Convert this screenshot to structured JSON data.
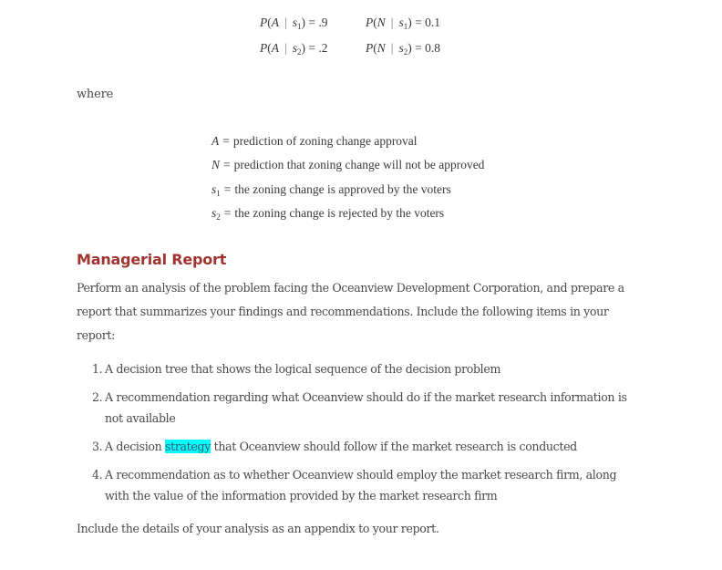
{
  "probabilities": [
    {
      "left": {
        "event": "A",
        "state": "s",
        "state_index": "1",
        "value": ".9"
      },
      "right": {
        "event": "N",
        "state": "s",
        "state_index": "1",
        "value": "0.1"
      }
    },
    {
      "left": {
        "event": "A",
        "state": "s",
        "state_index": "2",
        "value": ".2"
      },
      "right": {
        "event": "N",
        "state": "s",
        "state_index": "2",
        "value": "0.8"
      }
    }
  ],
  "where_label": "where",
  "definitions": [
    {
      "symbol": "A",
      "subscript": "",
      "text": "prediction of zoning change approval"
    },
    {
      "symbol": "N",
      "subscript": "",
      "text": "prediction that zoning change will not be approved"
    },
    {
      "symbol": "s",
      "subscript": "1",
      "text": "the zoning change is approved by the voters"
    },
    {
      "symbol": "s",
      "subscript": "2",
      "text": "the zoning change is rejected by the voters"
    }
  ],
  "report": {
    "heading": "Managerial Report",
    "intro": "Perform an analysis of the problem facing the Oceanview Development Corporation, and prepare a report that summarizes your findings and recommendations. Include the following items in your report:",
    "items": [
      {
        "number": "1.",
        "before": "A decision tree that shows the logical sequence of the decision problem",
        "highlight": "",
        "after": ""
      },
      {
        "number": "2.",
        "before": "A recommendation regarding what Oceanview should do if the market research information is not available",
        "highlight": "",
        "after": ""
      },
      {
        "number": "3.",
        "before": "A decision ",
        "highlight": "strategy",
        "after": " that Oceanview should follow if the market research is conducted"
      },
      {
        "number": "4.",
        "before": "A recommendation as to whether Oceanview should employ the market research firm, along with the value of the information provided by the market research firm",
        "highlight": "",
        "after": ""
      }
    ],
    "closing": "Include the details of your analysis as an appendix to your report."
  },
  "colors": {
    "heading": "#a0342f",
    "highlight": "#00ffff",
    "body_text": "#4a4a4a"
  }
}
